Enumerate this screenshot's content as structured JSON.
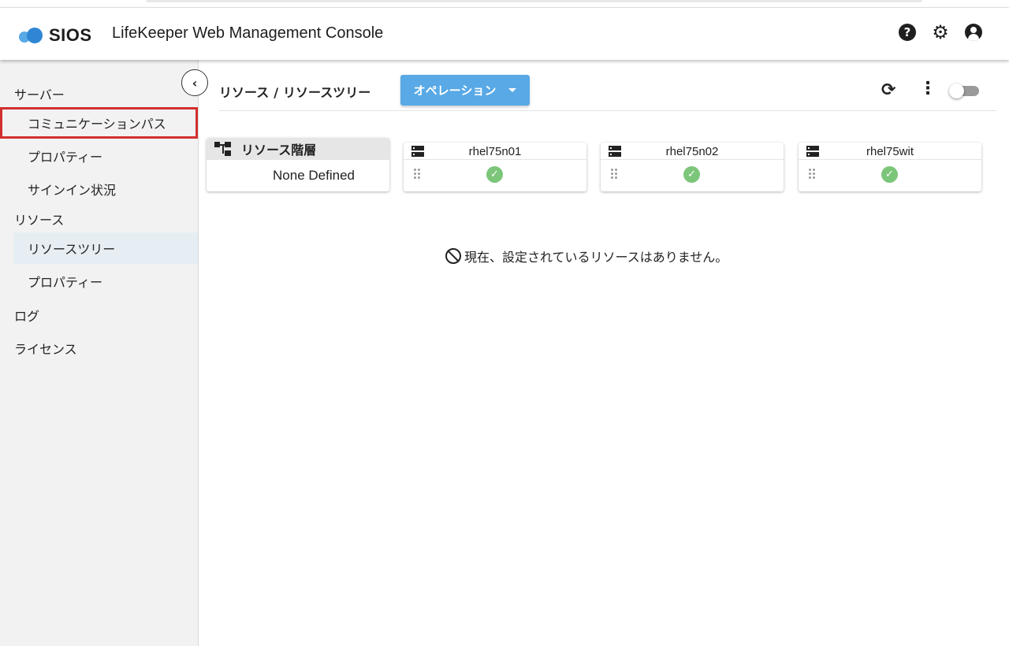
{
  "app": {
    "logo_text": "SIOS",
    "title": "LifeKeeper Web Management Console"
  },
  "header_icons": [
    "help-icon",
    "settings-gear-icon",
    "account-icon"
  ],
  "sidebar": {
    "groups": [
      {
        "label": "サーバー",
        "items": [
          "コミュニケーションパス",
          "プロパティー",
          "サインイン状況"
        ]
      },
      {
        "label": "リソース",
        "items": [
          "リソースツリー",
          "プロパティー"
        ]
      },
      {
        "label": "ログ",
        "items": []
      },
      {
        "label": "ライセンス",
        "items": []
      }
    ],
    "active_item": "リソースツリー",
    "highlighted_item": "コミュニケーションパス"
  },
  "main": {
    "breadcrumb": {
      "parent": "リソース",
      "separator": "/",
      "current": "リソースツリー"
    },
    "operation_button": "オペレーション",
    "hierarchy_card": {
      "title": "リソース階層",
      "value": "None Defined"
    },
    "servers": [
      {
        "name": "rhel75n01",
        "status": "ok"
      },
      {
        "name": "rhel75n02",
        "status": "ok"
      },
      {
        "name": "rhel75wit",
        "status": "ok"
      }
    ],
    "empty_message": "現在、設定されているリソースはありません。"
  },
  "colors": {
    "accent": "#58a9e6",
    "status_ok": "#7cc67a",
    "highlight_border": "#d32f2f",
    "sidebar_bg": "#f2f2f2",
    "active_item_bg": "#e6eef3"
  }
}
